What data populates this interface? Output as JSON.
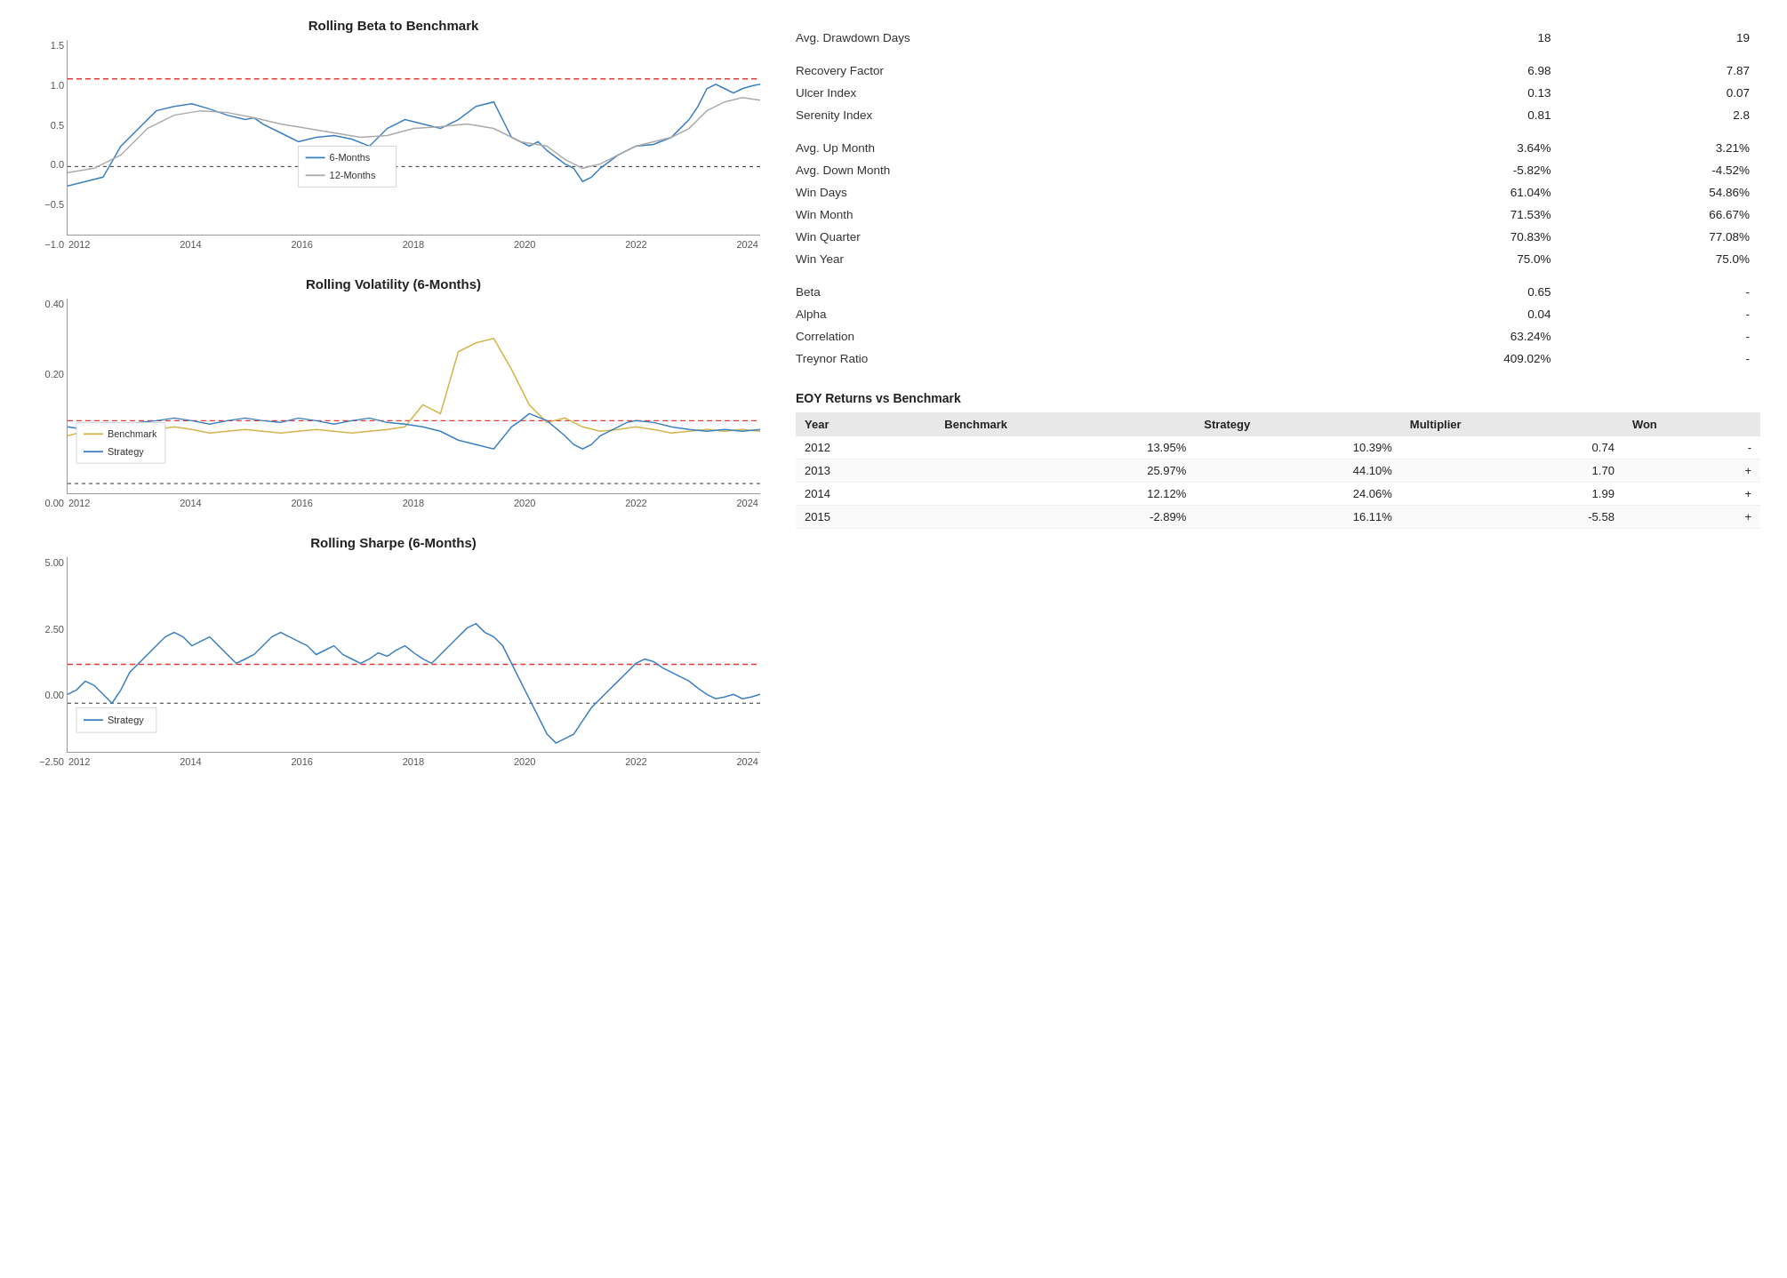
{
  "charts": {
    "rolling_beta": {
      "title": "Rolling Beta to Benchmark",
      "y_labels": [
        "1.5",
        "1.0",
        "0.5",
        "0.0",
        "-0.5",
        "-1.0"
      ],
      "x_labels": [
        "2012",
        "2014",
        "2016",
        "2018",
        "2020",
        "2022",
        "2024"
      ],
      "legend": [
        {
          "label": "6-Months",
          "color": "#3a7fc1",
          "style": "solid"
        },
        {
          "label": "12-Months",
          "color": "#999",
          "style": "solid"
        }
      ],
      "red_line_y_pct": 27,
      "black_line_y_pct": 65
    },
    "rolling_volatility": {
      "title": "Rolling Volatility (6-Months)",
      "y_labels": [
        "0.40",
        "0.20",
        "0.00"
      ],
      "x_labels": [
        "2012",
        "2014",
        "2016",
        "2018",
        "2020",
        "2022",
        "2024"
      ],
      "legend": [
        {
          "label": "Benchmark",
          "color": "#d4b44a",
          "style": "solid"
        },
        {
          "label": "Strategy",
          "color": "#3a7fc1",
          "style": "solid"
        }
      ],
      "red_line_y_pct": 65,
      "black_line_y_pct": 95
    },
    "rolling_sharpe": {
      "title": "Rolling Sharpe (6-Months)",
      "y_labels": [
        "5.00",
        "2.50",
        "0.00",
        "-2.50"
      ],
      "x_labels": [
        "2012",
        "2014",
        "2016",
        "2018",
        "2020",
        "2022",
        "2024"
      ],
      "legend": [
        {
          "label": "Strategy",
          "color": "#3a7fc1",
          "style": "solid"
        }
      ],
      "red_line_y_pct": 55,
      "black_line_y_pct": 75
    }
  },
  "stats": {
    "rows": [
      {
        "label": "Avg. Drawdown Days",
        "col1": "18",
        "col2": "19"
      },
      {
        "label": "",
        "col1": "",
        "col2": ""
      },
      {
        "label": "Recovery Factor",
        "col1": "6.98",
        "col2": "7.87"
      },
      {
        "label": "Ulcer Index",
        "col1": "0.13",
        "col2": "0.07"
      },
      {
        "label": "Serenity Index",
        "col1": "0.81",
        "col2": "2.8"
      },
      {
        "label": "",
        "col1": "",
        "col2": ""
      },
      {
        "label": "Avg. Up Month",
        "col1": "3.64%",
        "col2": "3.21%"
      },
      {
        "label": "Avg. Down Month",
        "col1": "-5.82%",
        "col2": "-4.52%"
      },
      {
        "label": "Win Days",
        "col1": "61.04%",
        "col2": "54.86%"
      },
      {
        "label": "Win Month",
        "col1": "71.53%",
        "col2": "66.67%"
      },
      {
        "label": "Win Quarter",
        "col1": "70.83%",
        "col2": "77.08%"
      },
      {
        "label": "Win Year",
        "col1": "75.0%",
        "col2": "75.0%"
      },
      {
        "label": "",
        "col1": "",
        "col2": ""
      },
      {
        "label": "Beta",
        "col1": "0.65",
        "col2": "-"
      },
      {
        "label": "Alpha",
        "col1": "0.04",
        "col2": "-"
      },
      {
        "label": "Correlation",
        "col1": "63.24%",
        "col2": "-"
      },
      {
        "label": "Treynor Ratio",
        "col1": "409.02%",
        "col2": "-"
      }
    ]
  },
  "eoy": {
    "title": "EOY Returns vs Benchmark",
    "headers": [
      "Year",
      "Benchmark",
      "Strategy",
      "Multiplier",
      "Won"
    ],
    "rows": [
      {
        "year": "2012",
        "benchmark": "13.95%",
        "strategy": "10.39%",
        "multiplier": "0.74",
        "won": "-"
      },
      {
        "year": "2013",
        "benchmark": "25.97%",
        "strategy": "44.10%",
        "multiplier": "1.70",
        "won": "+"
      },
      {
        "year": "2014",
        "benchmark": "12.12%",
        "strategy": "24.06%",
        "multiplier": "1.99",
        "won": "+"
      },
      {
        "year": "2015",
        "benchmark": "-2.89%",
        "strategy": "16.11%",
        "multiplier": "-5.58",
        "won": "+"
      }
    ]
  }
}
